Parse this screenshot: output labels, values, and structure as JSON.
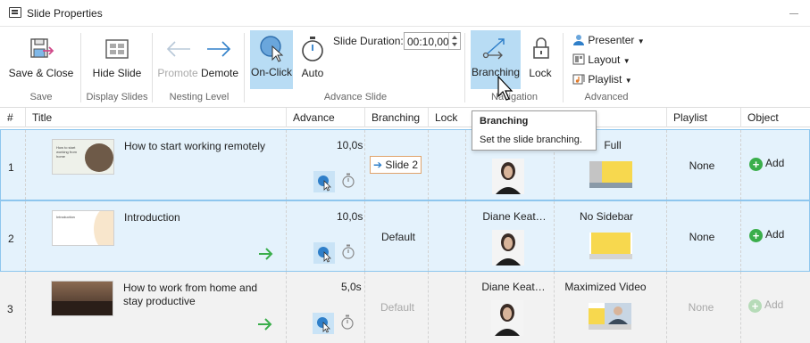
{
  "window": {
    "title": "Slide Properties"
  },
  "ribbon": {
    "save_close": "Save & Close",
    "hide_slide": "Hide Slide",
    "promote": "Promote",
    "demote": "Demote",
    "on_click": "On-Click",
    "auto": "Auto",
    "slide_duration_label": "Slide Duration:",
    "slide_duration_value": "00:10,00",
    "branching": "Branching",
    "lock": "Lock",
    "presenter": "Presenter",
    "layout": "Layout",
    "playlist": "Playlist",
    "groups": {
      "save": "Save",
      "display_slides": "Display Slides",
      "nesting_level": "Nesting Level",
      "advance_slide": "Advance Slide",
      "navigation": "Navigation",
      "advanced": "Advanced"
    }
  },
  "columns": {
    "num": "#",
    "title": "Title",
    "advance": "Advance",
    "branching": "Branching",
    "lock": "Lock",
    "playlist": "Playlist",
    "object": "Object"
  },
  "tooltip": {
    "title": "Branching",
    "body": "Set the slide branching."
  },
  "rows": [
    {
      "num": "1",
      "title": "How to start working remotely",
      "advance": "10,0s",
      "branching": "Slide 2",
      "presenter": "",
      "layout": "Full",
      "playlist": "None",
      "object": "Add",
      "thumb": "How to start working from home"
    },
    {
      "num": "2",
      "title": "Introduction",
      "advance": "10,0s",
      "branching": "Default",
      "presenter": "Diane Keat…",
      "layout": "No Sidebar",
      "playlist": "None",
      "object": "Add",
      "thumb": "Introduction"
    },
    {
      "num": "3",
      "title": "How to work from home and stay productive",
      "advance": "5,0s",
      "branching": "Default",
      "presenter": "Diane Keat…",
      "layout": "Maximized Video",
      "playlist": "None",
      "object": "Add",
      "thumb": ""
    }
  ],
  "colors": {
    "accent": "#2f7fc9",
    "active_bg": "#b8dcf4",
    "selected_row": "#e4f2fc",
    "add_green": "#3aae4b",
    "arrow_green": "#3aae4b"
  }
}
